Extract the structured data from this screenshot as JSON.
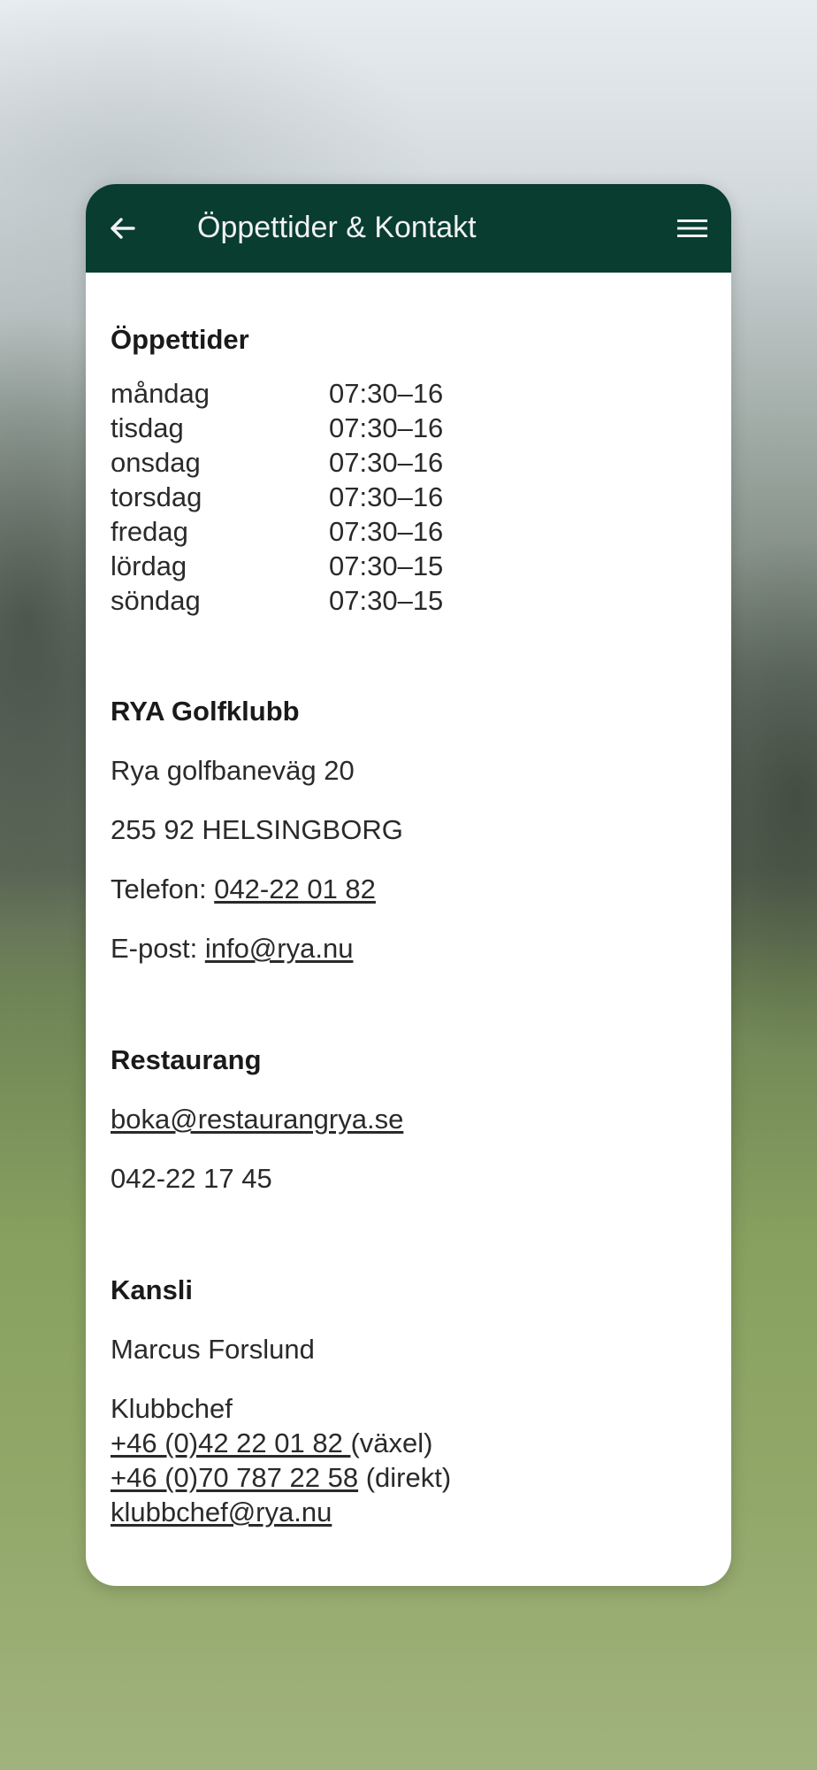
{
  "header": {
    "title": "Öppettider & Kontakt"
  },
  "opening_hours": {
    "heading": "Öppettider",
    "rows": [
      {
        "day": "måndag",
        "hours": "07:30–16"
      },
      {
        "day": "tisdag",
        "hours": "07:30–16"
      },
      {
        "day": "onsdag",
        "hours": "07:30–16"
      },
      {
        "day": "torsdag",
        "hours": "07:30–16"
      },
      {
        "day": "fredag",
        "hours": "07:30–16"
      },
      {
        "day": "lördag",
        "hours": "07:30–15"
      },
      {
        "day": "söndag",
        "hours": "07:30–15"
      }
    ]
  },
  "club": {
    "heading": "RYA Golfklubb",
    "street": "Rya golfbaneväg 20",
    "postal": "255 92 HELSINGBORG",
    "phone_label": "Telefon: ",
    "phone": "042-22 01 82",
    "email_label": "E-post: ",
    "email": "info@rya.nu"
  },
  "restaurant": {
    "heading": "Restaurang",
    "email": "boka@restaurangrya.se",
    "phone": "042-22 17 45"
  },
  "office": {
    "heading": "Kansli",
    "name": "Marcus Forslund",
    "role": "Klubbchef",
    "phone_switchboard": "+46 (0)42 22 01 82 ",
    "switchboard_suffix": "(växel)",
    "phone_direct": "+46 (0)70 787 22 58",
    "direct_suffix": " (direkt)",
    "email": "klubbchef@rya.nu"
  },
  "colors": {
    "header_bg": "#083d30",
    "header_text": "#f2f2f2",
    "card_bg": "#ffffff"
  },
  "icons": {
    "back": "arrow-left-icon",
    "menu": "hamburger-menu-icon"
  }
}
